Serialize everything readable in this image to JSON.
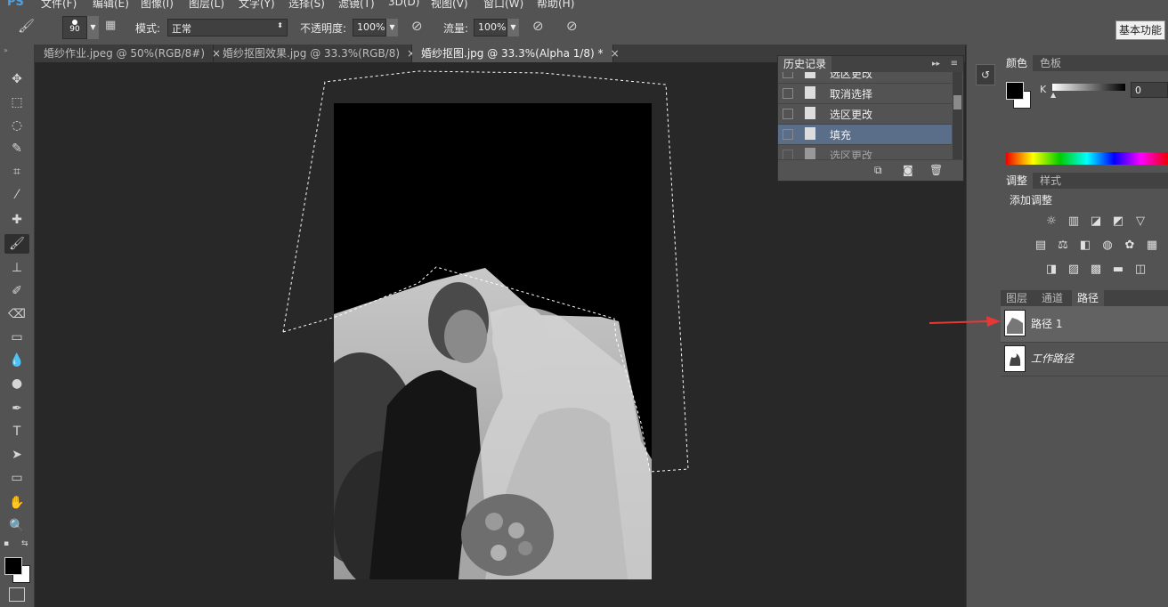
{
  "app": {
    "logo": "PS"
  },
  "menu": [
    "文件(F)",
    "编辑(E)",
    "图像(I)",
    "图层(L)",
    "文字(Y)",
    "选择(S)",
    "滤镜(T)",
    "3D(D)",
    "视图(V)",
    "窗口(W)",
    "帮助(H)"
  ],
  "options": {
    "brush_size": "90",
    "mode_label": "模式:",
    "mode_value": "正常",
    "opacity_label": "不透明度:",
    "opacity_value": "100%",
    "flow_label": "流量:",
    "flow_value": "100%",
    "workspace": "基本功能"
  },
  "tabs": [
    {
      "label": "婚纱作业.jpeg @ 50%(RGB/8#)",
      "close": "×",
      "active": false
    },
    {
      "label": "婚纱抠图效果.jpg @ 33.3%(RGB/8)",
      "close": "×",
      "active": false
    },
    {
      "label": "婚纱抠图.jpg @ 33.3%(Alpha 1/8) *",
      "close": "×",
      "active": true
    }
  ],
  "history": {
    "title": "历史记录",
    "items": [
      {
        "label": "选区更改",
        "selected": false
      },
      {
        "label": "取消选择",
        "selected": false
      },
      {
        "label": "选区更改",
        "selected": false
      },
      {
        "label": "填充",
        "selected": true
      },
      {
        "label": "选区更改",
        "selected": false
      }
    ]
  },
  "color_panel": {
    "tabs": [
      "颜色",
      "色板"
    ],
    "channel": "K",
    "value": "0"
  },
  "adjust_panel": {
    "tabs": [
      "调整",
      "样式"
    ],
    "heading": "添加调整"
  },
  "layers_panel": {
    "tabs": [
      "图层",
      "通道",
      "路径"
    ],
    "paths": [
      {
        "label": "路径 1"
      },
      {
        "label": "工作路径"
      }
    ]
  },
  "colors": {
    "foreground": "#000000",
    "background": "#ffffff",
    "accent_arrow": "#e53935",
    "history_selected": "#5a6e8a"
  }
}
